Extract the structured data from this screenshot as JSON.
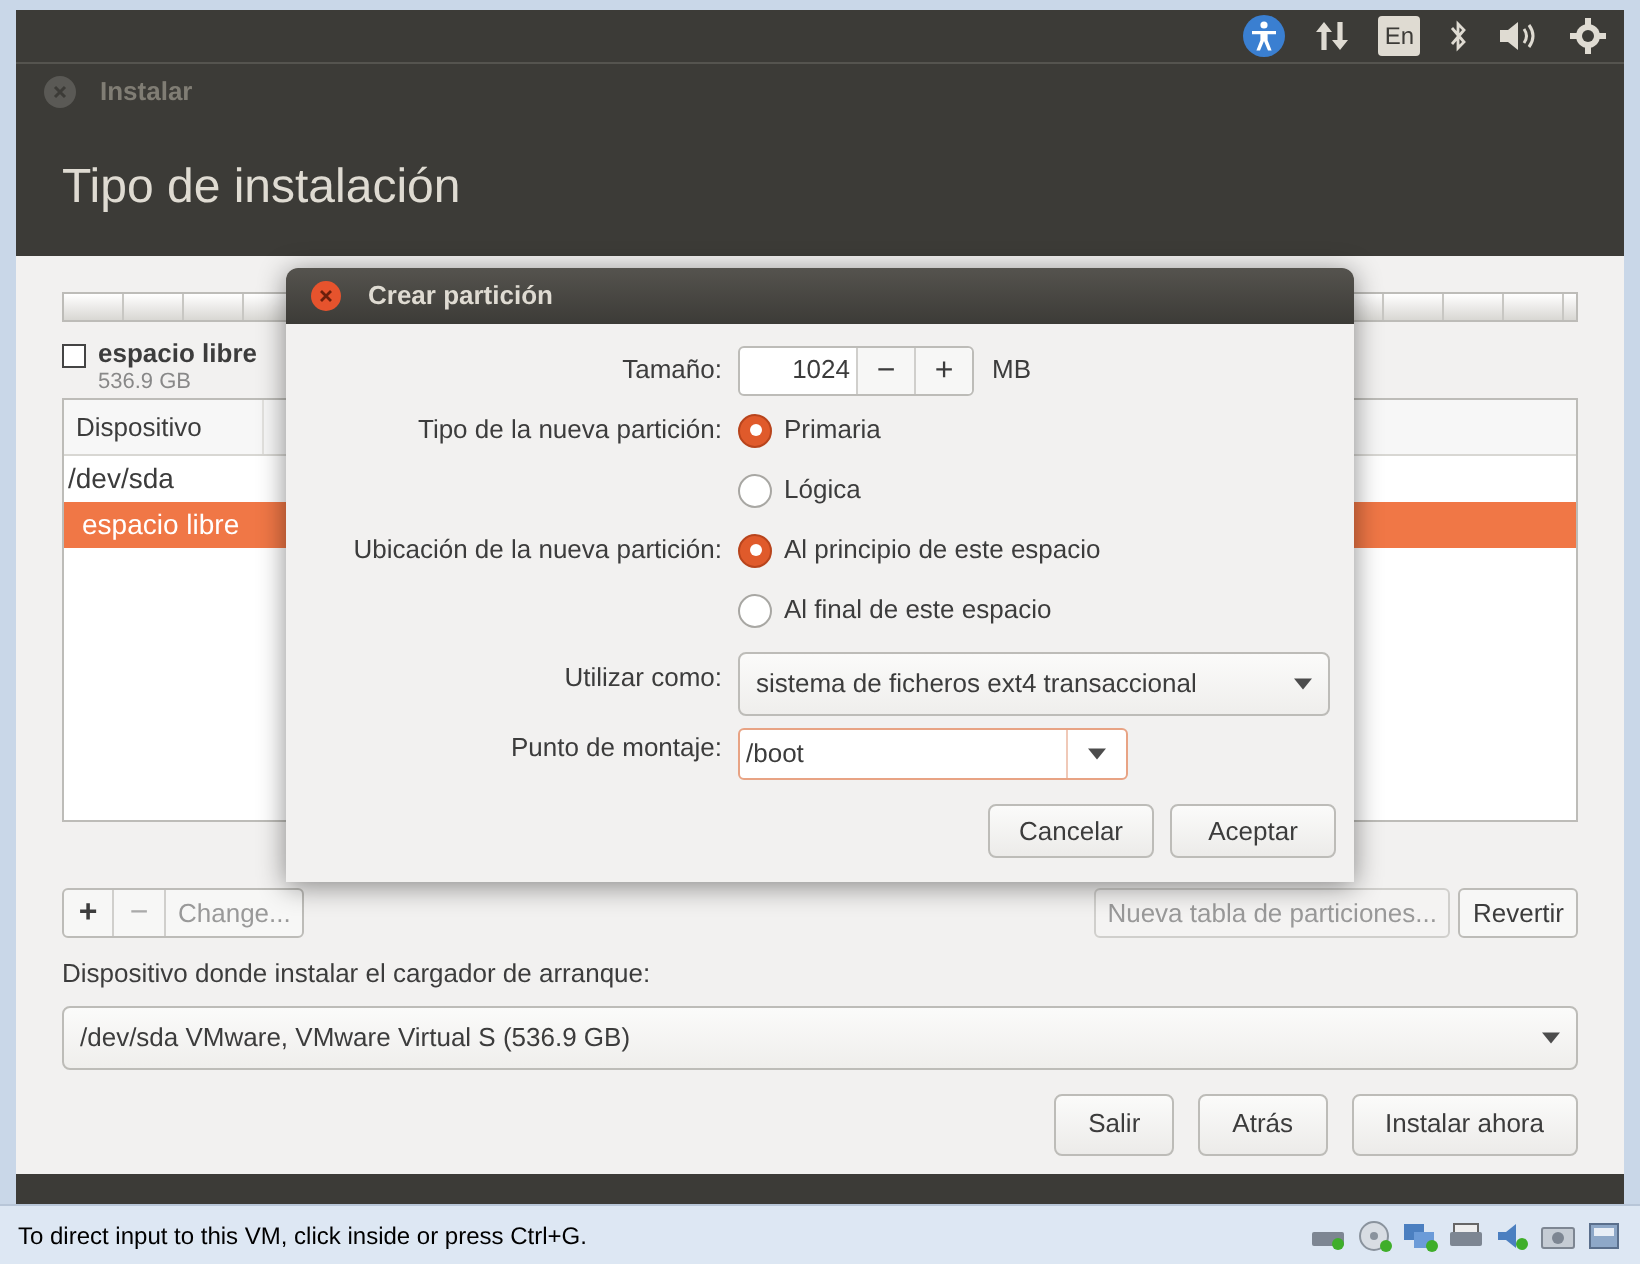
{
  "top_panel": {
    "keyboard_layout": "En"
  },
  "window": {
    "title": "Instalar",
    "heading": "Tipo de instalación"
  },
  "partition_legend": {
    "label": "espacio libre",
    "size": "536.9 GB",
    "checked": false
  },
  "table": {
    "columns": [
      "Dispositivo"
    ],
    "rows": [
      {
        "device": "/dev/sda",
        "selected": false,
        "children": [
          {
            "device": "espacio libre",
            "selected": true
          }
        ]
      }
    ]
  },
  "table_toolbar": {
    "add": "+",
    "remove": "−",
    "change": "Change...",
    "new_table": "Nueva tabla de particiones...",
    "revert": "Revertir"
  },
  "bootloader": {
    "label": "Dispositivo donde instalar el cargador de arranque:",
    "value": "/dev/sda  VMware, VMware Virtual S (536.9 GB)"
  },
  "buttons": [
    {
      "label": "Salir"
    },
    {
      "label": "Atrás"
    },
    {
      "label": "Instalar ahora"
    }
  ],
  "dialog": {
    "title": "Crear partición",
    "size": {
      "label": "Tamaño:",
      "value": "1024",
      "minus": "−",
      "plus": "+",
      "unit": "MB"
    },
    "type": {
      "label": "Tipo de la nueva partición:",
      "options": [
        {
          "label": "Primaria",
          "selected": true
        },
        {
          "label": "Lógica",
          "selected": false
        }
      ]
    },
    "location": {
      "label": "Ubicación de la nueva partición:",
      "options": [
        {
          "label": "Al principio de este espacio",
          "selected": true
        },
        {
          "label": "Al final de este espacio",
          "selected": false
        }
      ]
    },
    "use_as": {
      "label": "Utilizar como:",
      "value": "sistema de ficheros ext4 transaccional"
    },
    "mount_point": {
      "label": "Punto de montaje:",
      "value": "/boot"
    },
    "buttons": [
      {
        "label": "Cancelar"
      },
      {
        "label": "Aceptar"
      }
    ]
  },
  "status_bar": {
    "text": "To direct input to this VM, click inside or press Ctrl+G."
  }
}
